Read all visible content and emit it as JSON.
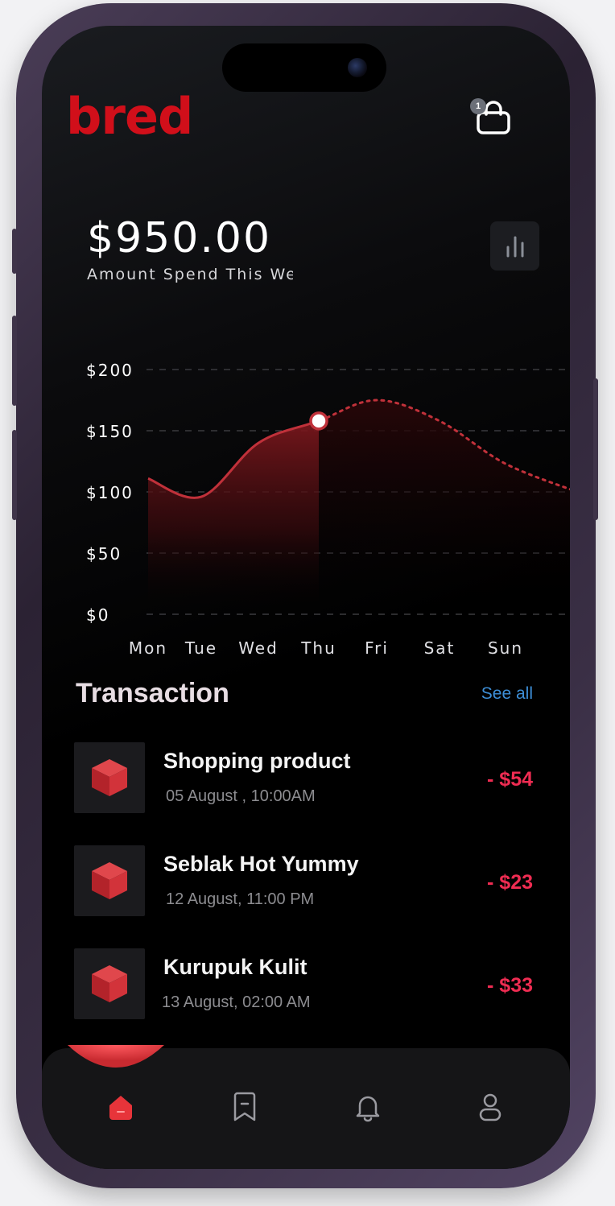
{
  "brand": {
    "name": "bred",
    "color": "#d10f1a"
  },
  "header": {
    "cart_icon": "shopping-bag-icon",
    "cart_count": "1"
  },
  "summary": {
    "amount": "$950.00",
    "label": "Amount Spend This Week",
    "stats_icon": "bar-chart-icon"
  },
  "chart_data": {
    "type": "area",
    "categories": [
      "Mon",
      "Tue",
      "Wed",
      "Thu",
      "Fri",
      "Sat",
      "Sun"
    ],
    "y_ticks": [
      "$200",
      "$150",
      "$100",
      "$50",
      "$0"
    ],
    "ylim": [
      0,
      200
    ],
    "series": [
      {
        "values": [
          111,
          96,
          140,
          158,
          175,
          158,
          123
        ]
      }
    ],
    "actual_through": "Thu",
    "grid": true,
    "accent": "#c0313a"
  },
  "transactions": {
    "title": "Transaction",
    "see_all": "See all",
    "items": [
      {
        "name": "Shopping product",
        "date": "05 August , 10:00AM",
        "amount": "- $54",
        "icon": "cube-icon"
      },
      {
        "name": "Seblak Hot Yummy",
        "date": "12 August, 11:00 PM",
        "amount": "- $23",
        "icon": "cube-icon"
      },
      {
        "name": "Kurupuk Kulit",
        "date": "13 August, 02:00 AM",
        "amount": "- $33",
        "icon": "cube-icon"
      }
    ]
  },
  "nav": {
    "items": [
      {
        "icon": "home-icon",
        "active": true
      },
      {
        "icon": "bookmark-icon",
        "active": false
      },
      {
        "icon": "bell-icon",
        "active": false
      },
      {
        "icon": "profile-icon",
        "active": false
      }
    ]
  },
  "colors": {
    "background": "#000000",
    "negative": "#ef2c52",
    "link": "#3d8ed6"
  }
}
